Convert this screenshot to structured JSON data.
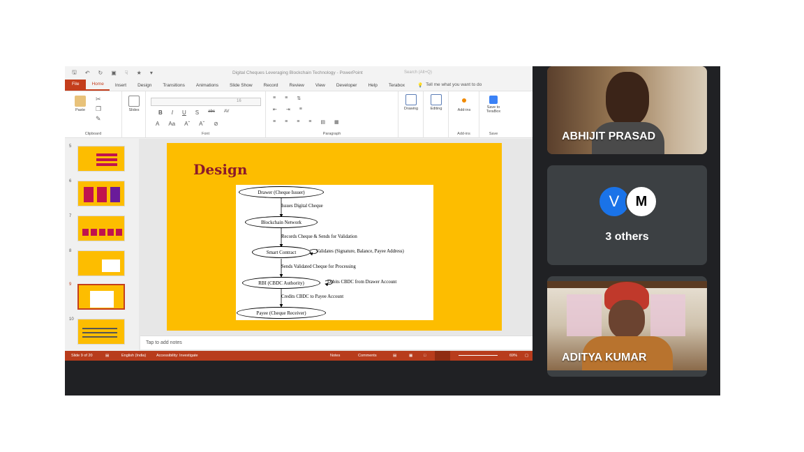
{
  "ppt": {
    "doc_title": "Digital Cheques Leveraging Blockchain Technology  -  PowerPoint",
    "search_hint": "Search (Alt+Q)",
    "menu": [
      "File",
      "Home",
      "Insert",
      "Design",
      "Transitions",
      "Animations",
      "Slide Show",
      "Record",
      "Review",
      "View",
      "Developer",
      "Help",
      "Terabox"
    ],
    "tell_me": "Tell me what you want to do",
    "ribbon": {
      "paste": "Paste",
      "clipboard": "Clipboard",
      "slides": "Slides",
      "font": "Font",
      "font_size": "16",
      "paragraph": "Paragraph",
      "drawing": "Drawing",
      "editing": "Editing",
      "addins_btn": "Add-ins",
      "addins": "Add-ins",
      "save_terabox": "Save to TeraBox",
      "save": "Save"
    },
    "thumbnails": [
      {
        "num": "5"
      },
      {
        "num": "6"
      },
      {
        "num": "7"
      },
      {
        "num": "8"
      },
      {
        "num": "9"
      },
      {
        "num": "10"
      }
    ],
    "slide": {
      "title": "Design",
      "nodes": {
        "drawer": "Drawer (Cheque Issuer)",
        "blockchain": "Blockchain Network",
        "smart": "Smart Contract",
        "rbi": "RBI (CBDC Authority)",
        "payee": "Payee (Cheque Receiver)"
      },
      "edges": {
        "e1": "Issues Digital Cheque",
        "e2": "Records Cheque & Sends for Validation",
        "e3": "Validates (Signature, Balance, Payee Address)",
        "e4": "Sends Validated Cheque for Processing",
        "e5": "Debits CBDC from Drawer Account",
        "e6": "Credits CBDC to Payee Account"
      }
    },
    "notes_placeholder": "Tap to add notes",
    "status": {
      "slide": "Slide 9 of 20",
      "language": "English (India)",
      "accessibility": "Accessibility: Investigate",
      "notes": "Notes",
      "comments": "Comments",
      "zoom": "69%"
    }
  },
  "participants": [
    {
      "name": "ABHIJIT PRASAD"
    },
    {
      "others_label": "3 others",
      "avatar1": "V",
      "avatar2": "M"
    },
    {
      "name": "ADITYA KUMAR"
    }
  ]
}
